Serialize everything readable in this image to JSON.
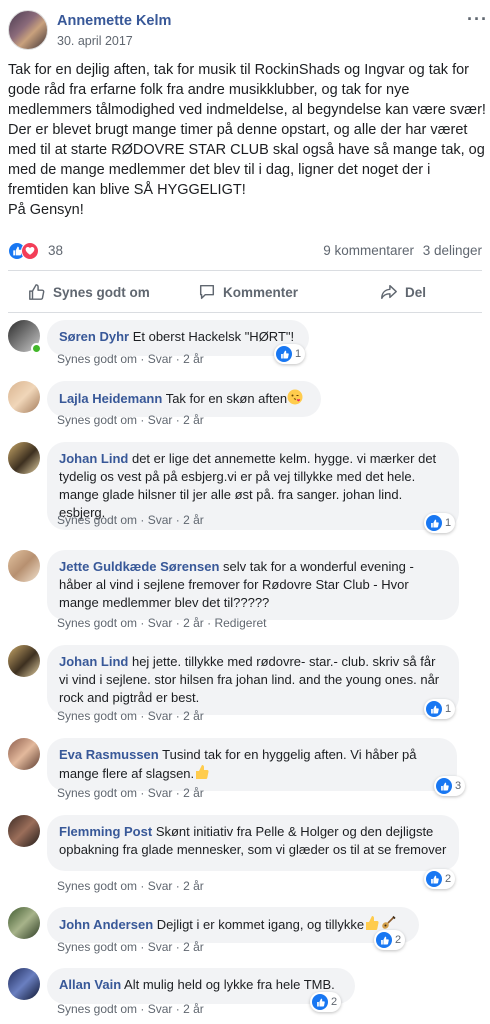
{
  "post": {
    "author": "Annemette Kelm",
    "date": "30. april 2017",
    "more": "···",
    "body": [
      "Tak for en dejlig aften, tak for musik til RockinShads og Ingvar og tak for gode råd fra erfarne folk fra andre musikklubber, og tak for nye medlemmers tålmodighed ved indmeldelse, al begyndelse kan være svær!",
      "Der er blevet brugt mange timer på denne opstart, og alle der har været med til at starte RØDOVRE STAR CLUB skal også have så mange tak, og med de mange medlemmer det blev til i dag, ligner det noget der i fremtiden kan blive SÅ HYGGELIGT!",
      "På Gensyn!"
    ],
    "reaction_count": "38",
    "comment_count": "9 kommentarer",
    "share_count": "3 delinger"
  },
  "actions": {
    "like": "Synes godt om",
    "comment": "Kommenter",
    "share": "Del"
  },
  "colors": {
    "link": "#385898",
    "like_blue": "#1877f2",
    "love_red": "#f33e58",
    "bubble_bg": "#f2f3f5",
    "online": "#42b72a"
  },
  "comments": [
    {
      "name": "Søren Dyhr",
      "text": "Et oberst Hackelsk \"HØRT\"!",
      "like": "Synes godt om",
      "reply": "Svar",
      "age": "2 år",
      "likes": "1",
      "edited": ""
    },
    {
      "name": "Lajla Heidemann",
      "text": "Tak for en skøn aften",
      "like": "Synes godt om",
      "reply": "Svar",
      "age": "2 år",
      "likes": "",
      "edited": "",
      "emoji": "kiss-emoji"
    },
    {
      "name": "Johan Lind",
      "text": "det er lige det annemette kelm. hygge. vi mærker det tydelig os vest på på esbjerg.vi er på vej tillykke med det hele. mange glade hilsner til jer alle øst på. fra sanger. johan lind. esbjerg.",
      "like": "Synes godt om",
      "reply": "Svar",
      "age": "2 år",
      "likes": "1",
      "edited": ""
    },
    {
      "name": "Jette Guldkæde Sørensen",
      "text": "selv tak for a wonderful evening - håber al vind i sejlene fremover for Rødovre Star Club - Hvor mange medlemmer blev det til?????",
      "like": "Synes godt om",
      "reply": "Svar",
      "age": "2 år",
      "likes": "",
      "edited": "Redigeret"
    },
    {
      "name": "Johan Lind",
      "text": "hej jette. tillykke med rødovre- star.- club. skriv så får vi vind i sejlene. stor hilsen fra johan lind. and the young ones. når rock and pigtråd er best.",
      "like": "Synes godt om",
      "reply": "Svar",
      "age": "2 år",
      "likes": "1",
      "edited": ""
    },
    {
      "name": "Eva Rasmussen",
      "text": "Tusind tak for en hyggelig aften. Vi håber på mange flere af slagsen.",
      "like": "Synes godt om",
      "reply": "Svar",
      "age": "2 år",
      "likes": "3",
      "edited": "",
      "emoji": "thumbs-up-emoji"
    },
    {
      "name": "Flemming Post",
      "text": "Skønt initiativ fra Pelle & Holger og den dejligste opbakning fra glade mennesker, som vi glæder os til at se fremover",
      "like": "Synes godt om",
      "reply": "Svar",
      "age": "2 år",
      "likes": "2",
      "edited": ""
    },
    {
      "name": "John Andersen",
      "text": "Dejligt i er kommet igang, og tillykke",
      "like": "Synes godt om",
      "reply": "Svar",
      "age": "2 år",
      "likes": "2",
      "edited": "",
      "emoji": "thumbs-up-guitar-emoji"
    },
    {
      "name": "Allan Vain",
      "text": "Alt mulig held og lykke fra hele TMB.",
      "like": "Synes godt om",
      "reply": "Svar",
      "age": "2 år",
      "likes": "2",
      "edited": ""
    }
  ]
}
